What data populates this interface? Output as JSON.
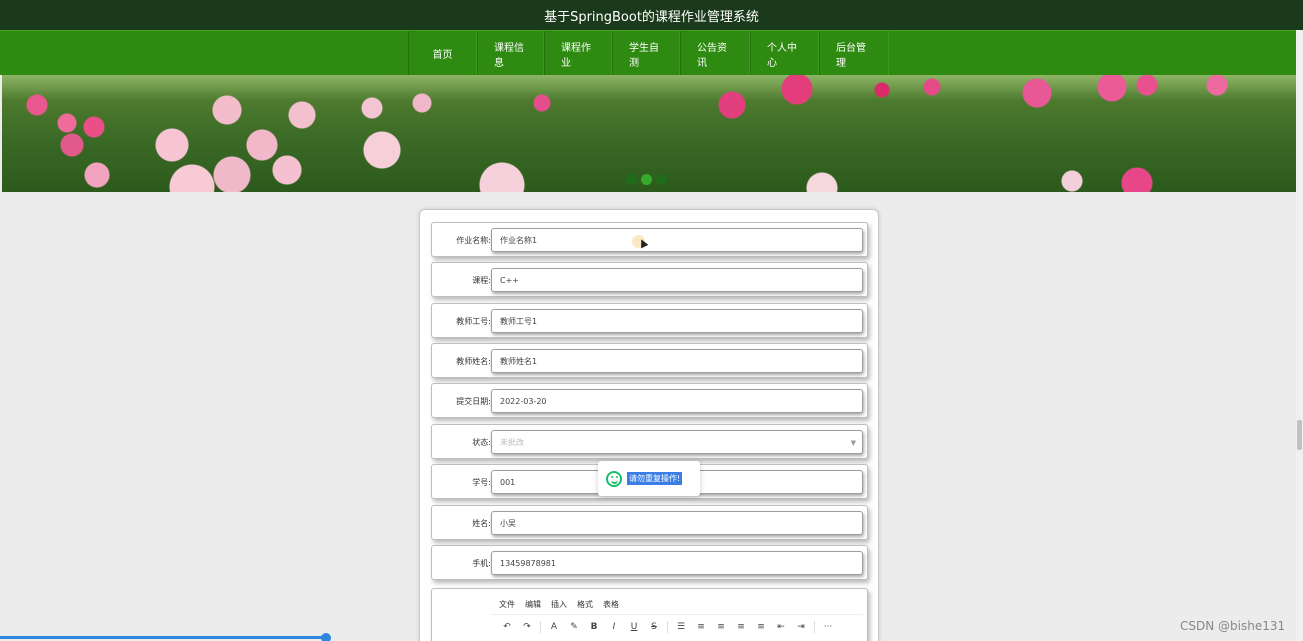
{
  "header": {
    "title": "基于SpringBoot的课程作业管理系统"
  },
  "nav": {
    "items": [
      {
        "label": "首页"
      },
      {
        "label": "课程信息"
      },
      {
        "label": "课程作业"
      },
      {
        "label": "学生自测"
      },
      {
        "label": "公告资讯"
      },
      {
        "label": "个人中心"
      },
      {
        "label": "后台管理"
      }
    ]
  },
  "carousel": {
    "slide_count": 3,
    "active_index": 1
  },
  "form": {
    "fields": [
      {
        "label": "作业名称:",
        "value": "作业名称1"
      },
      {
        "label": "课程:",
        "value": "C++"
      },
      {
        "label": "教师工号:",
        "value": "教师工号1"
      },
      {
        "label": "教师姓名:",
        "value": "教师姓名1"
      },
      {
        "label": "提交日期:",
        "value": "2022-03-20"
      },
      {
        "label": "状态:",
        "value": "未批改"
      },
      {
        "label": "学号:",
        "value": "001"
      },
      {
        "label": "姓名:",
        "value": "小吴"
      },
      {
        "label": "手机:",
        "value": "13459878981"
      }
    ],
    "editor": {
      "menus": [
        "文件",
        "编辑",
        "插入",
        "格式",
        "表格"
      ],
      "tools": [
        "↶",
        "↷",
        "A",
        "✎",
        "B",
        "I",
        "U",
        "S",
        "☰",
        "≡",
        "≡",
        "≡",
        "≡",
        "⇤",
        "⇥",
        "···"
      ]
    }
  },
  "toast": {
    "message": "请勿重复操作!"
  },
  "watermark": "CSDN @bishe131",
  "colors": {
    "topbar": "#1a3a1b",
    "nav": "#2e8a10",
    "toast_icon": "#19be6b",
    "selection": "#3b7fe6"
  }
}
